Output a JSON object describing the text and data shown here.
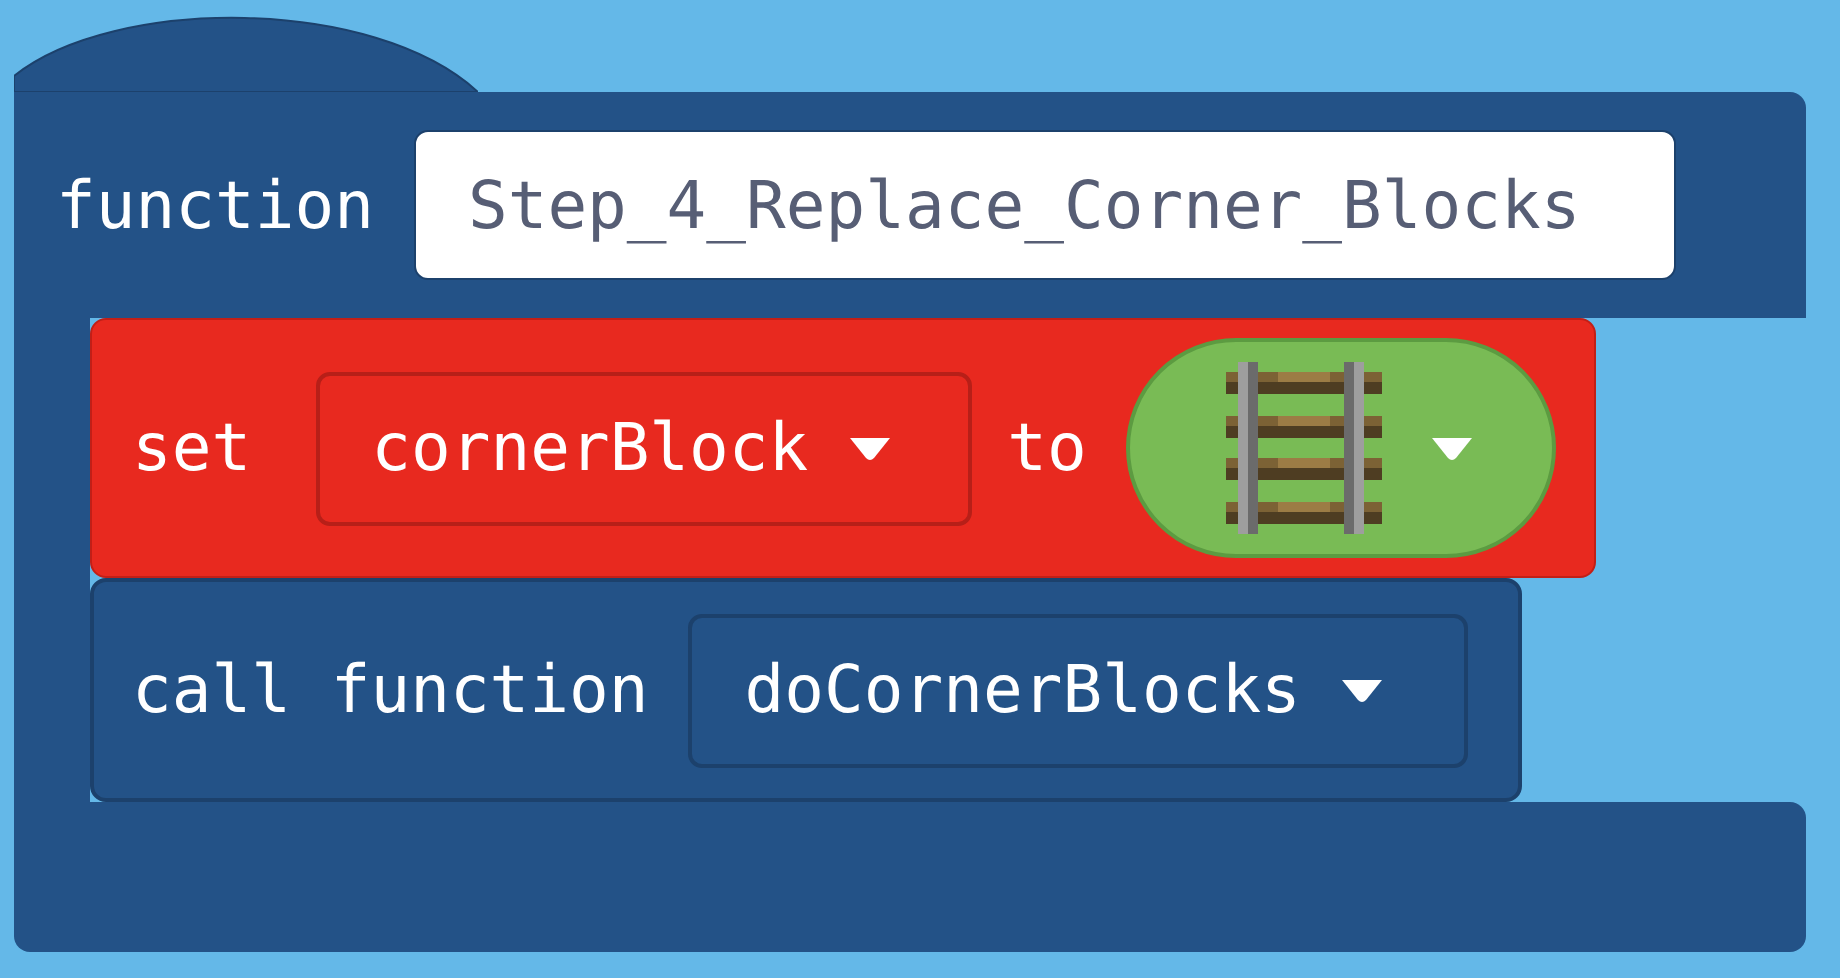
{
  "function_block": {
    "keyword": "function",
    "name": "Step_4_Replace_Corner_Blocks"
  },
  "statements": [
    {
      "kind": "set",
      "keyword": "set",
      "variable": "cornerBlock",
      "connector": "to"
    },
    {
      "kind": "call",
      "keyword": "call function",
      "function": "doCornerBlocks"
    }
  ]
}
